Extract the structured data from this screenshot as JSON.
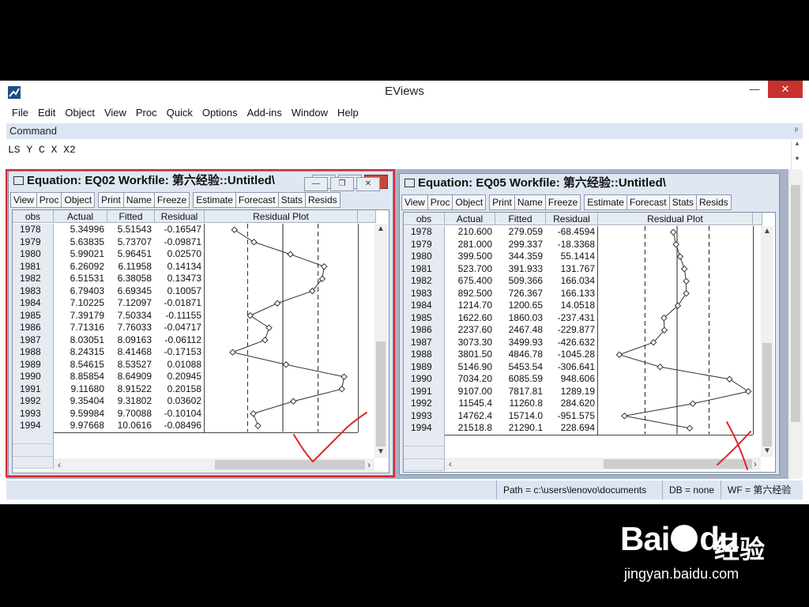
{
  "app": {
    "title": "EViews"
  },
  "menu": [
    "File",
    "Edit",
    "Object",
    "View",
    "Proc",
    "Quick",
    "Options",
    "Add-ins",
    "Window",
    "Help"
  ],
  "command": {
    "label": "Command",
    "text": "LS  Y  C  X  X2"
  },
  "toolbar_buttons": [
    "View",
    "Proc",
    "Object",
    "Print",
    "Name",
    "Freeze",
    "Estimate",
    "Forecast",
    "Stats",
    "Resids"
  ],
  "columns": [
    "obs",
    "Actual",
    "Fitted",
    "Residual",
    "Residual Plot"
  ],
  "status": {
    "path": "Path = c:\\users\\lenovo\\documents",
    "db": "DB = none",
    "wf": "WF = 第六经验"
  },
  "windows": [
    {
      "title": "Equation: EQ02   Workfile: 第六经验::Untitled\\",
      "rows": [
        [
          "1978",
          "5.34996",
          "5.51543",
          "-0.16547"
        ],
        [
          "1979",
          "5.63835",
          "5.73707",
          "-0.09871"
        ],
        [
          "1980",
          "5.99021",
          "5.96451",
          "0.02570"
        ],
        [
          "1981",
          "6.26092",
          "6.11958",
          "0.14134"
        ],
        [
          "1982",
          "6.51531",
          "6.38058",
          "0.13473"
        ],
        [
          "1983",
          "6.79403",
          "6.69345",
          "0.10057"
        ],
        [
          "1984",
          "7.10225",
          "7.12097",
          "-0.01871"
        ],
        [
          "1985",
          "7.39179",
          "7.50334",
          "-0.11155"
        ],
        [
          "1986",
          "7.71316",
          "7.76033",
          "-0.04717"
        ],
        [
          "1987",
          "8.03051",
          "8.09163",
          "-0.06112"
        ],
        [
          "1988",
          "8.24315",
          "8.41468",
          "-0.17153"
        ],
        [
          "1989",
          "8.54615",
          "8.53527",
          "0.01088"
        ],
        [
          "1990",
          "8.85854",
          "8.64909",
          "0.20945"
        ],
        [
          "1991",
          "9.11680",
          "8.91522",
          "0.20158"
        ],
        [
          "1992",
          "9.35404",
          "9.31802",
          "0.03602"
        ],
        [
          "1993",
          "9.59984",
          "9.70088",
          "-0.10104"
        ],
        [
          "1994",
          "9.97668",
          "10.0616",
          "-0.08496"
        ]
      ],
      "residual_values": [
        -0.16547,
        -0.09871,
        0.0257,
        0.14134,
        0.13473,
        0.10057,
        -0.01871,
        -0.11155,
        -0.04717,
        -0.06112,
        -0.17153,
        0.01088,
        0.20945,
        0.20158,
        0.03602,
        -0.10104,
        -0.08496
      ],
      "band_sigma": 0.1205
    },
    {
      "title": "Equation: EQ05   Workfile: 第六经验::Untitled\\",
      "rows": [
        [
          "1978",
          "210.600",
          "279.059",
          "-68.4594"
        ],
        [
          "1979",
          "281.000",
          "299.337",
          "-18.3368"
        ],
        [
          "1980",
          "399.500",
          "344.359",
          "55.1414"
        ],
        [
          "1981",
          "523.700",
          "391.933",
          "131.767"
        ],
        [
          "1982",
          "675.400",
          "509.366",
          "166.034"
        ],
        [
          "1983",
          "892.500",
          "726.367",
          "166.133"
        ],
        [
          "1984",
          "1214.70",
          "1200.65",
          "14.0518"
        ],
        [
          "1985",
          "1622.60",
          "1860.03",
          "-237.431"
        ],
        [
          "1986",
          "2237.60",
          "2467.48",
          "-229.877"
        ],
        [
          "1987",
          "3073.30",
          "3499.93",
          "-426.632"
        ],
        [
          "1988",
          "3801.50",
          "4846.78",
          "-1045.28"
        ],
        [
          "1989",
          "5146.90",
          "5453.54",
          "-306.641"
        ],
        [
          "1990",
          "7034.20",
          "6085.59",
          "948.606"
        ],
        [
          "1991",
          "9107.00",
          "7817.81",
          "1289.19"
        ],
        [
          "1992",
          "11545.4",
          "11260.8",
          "284.620"
        ],
        [
          "1993",
          "14762.4",
          "15714.0",
          "-951.575"
        ],
        [
          "1994",
          "21518.8",
          "21290.1",
          "228.694"
        ]
      ],
      "residual_values": [
        -68.4594,
        -18.3368,
        55.1414,
        131.767,
        166.034,
        166.133,
        14.0518,
        -237.431,
        -229.877,
        -426.632,
        -1045.28,
        -306.641,
        948.606,
        1289.19,
        284.62,
        -951.575,
        228.694
      ],
      "band_sigma": 580
    }
  ],
  "watermark": {
    "brand": "Bai",
    "brand_tail": "du",
    "cn": "经验",
    "url": "jingyan.baidu.com"
  },
  "colors": {
    "highlight": "#d9272e",
    "ink": "#e0242b",
    "workarea": "#a6b4c6",
    "panel": "#dce6f3"
  }
}
